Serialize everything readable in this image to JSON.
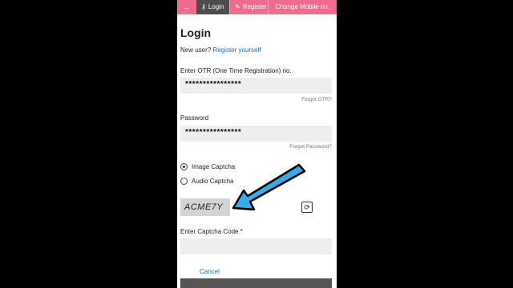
{
  "tabs": {
    "back_icon": "←",
    "login": "Login",
    "register": "Register",
    "change_mobile": "Change Mobile no."
  },
  "page": {
    "title": "Login",
    "new_user_prefix": "New user?",
    "register_link": "Register yourself"
  },
  "otr": {
    "label": "Enter OTR (One Time Registration) no.",
    "value": "****************",
    "forgot": "Forgot OTR?"
  },
  "password": {
    "label": "Password",
    "value": "****************",
    "forgot": "Forgot Password?"
  },
  "captcha": {
    "options": [
      "Image Captcha",
      "Audio Captcha"
    ],
    "selected": "Image Captcha",
    "image_text": "ACME7Y",
    "refresh_icon": "refresh-icon",
    "code_label": "Enter Captcha Code *",
    "code_value": ""
  },
  "actions": {
    "cancel": "Cancel"
  },
  "colors": {
    "tab_bar": "#f06b8d",
    "active_tab": "#4d4d4d",
    "link": "#1f6fb5",
    "annotation_arrow": "#3aa9e8"
  }
}
